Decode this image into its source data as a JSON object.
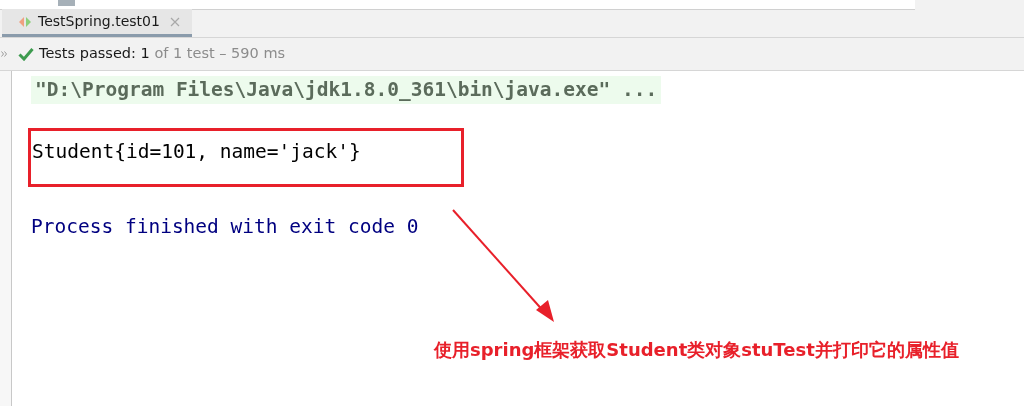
{
  "tab": {
    "title": "TestSpring.test01",
    "selected": true
  },
  "status": {
    "label": "Tests passed:",
    "passed": "1",
    "summary": "of 1 test – 590 ms"
  },
  "console": {
    "lines": [
      {
        "kind": "command",
        "text": "\"D:\\Program Files\\Java\\jdk1.8.0_361\\bin\\java.exe\" ..."
      },
      {
        "kind": "output",
        "text": "Student{id=101, name='jack'}",
        "highlighted": true
      },
      {
        "kind": "exit",
        "text": "Process finished with exit code 0"
      }
    ]
  },
  "annotation": {
    "text": "使用spring框架获取Student类对象stuTest并打印它的属性值"
  }
}
